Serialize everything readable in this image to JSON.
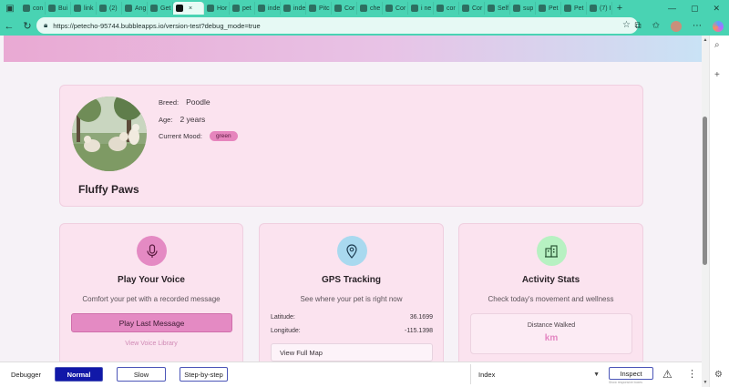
{
  "browser": {
    "tabs": [
      {
        "label": "con",
        "icon": "page-icon"
      },
      {
        "label": "Bui",
        "icon": "s-icon"
      },
      {
        "label": "link",
        "icon": "page-icon"
      },
      {
        "label": "(2)",
        "icon": "linkedin-icon"
      },
      {
        "label": "Ang",
        "icon": "page-icon"
      },
      {
        "label": "Get",
        "icon": "gear-icon"
      },
      {
        "label": "",
        "icon": "bubble-icon",
        "active": true,
        "close": "×"
      },
      {
        "label": "Hor",
        "icon": "bubble-icon"
      },
      {
        "label": "pet",
        "icon": "page-icon"
      },
      {
        "label": "inde",
        "icon": "bubble-icon"
      },
      {
        "label": "inde",
        "icon": "bubble-icon"
      },
      {
        "label": "Pitc",
        "icon": "page-icon"
      },
      {
        "label": "Cor",
        "icon": "page-icon"
      },
      {
        "label": "che",
        "icon": "page-icon"
      },
      {
        "label": "Cor",
        "icon": "google-icon"
      },
      {
        "label": "i ne",
        "icon": "page-icon"
      },
      {
        "label": "cor",
        "icon": "page-icon"
      },
      {
        "label": "Cor",
        "icon": "page-icon"
      },
      {
        "label": "Self",
        "icon": "n-icon"
      },
      {
        "label": "sup",
        "icon": "n-icon"
      },
      {
        "label": "Pet",
        "icon": "n-icon"
      },
      {
        "label": "Pet",
        "icon": "n-icon"
      },
      {
        "label": "(7) I",
        "icon": "x-icon"
      }
    ],
    "new_tab": "+",
    "url": "https://petecho-95744.bubbleapps.io/version-test?debug_mode=true"
  },
  "profile": {
    "breed_label": "Breed:",
    "breed_value": "Poodle",
    "age_label": "Age:",
    "age_value": "2 years",
    "mood_label": "Current Mood:",
    "mood_value": "green",
    "pet_name": "Fluffy Paws"
  },
  "features": {
    "voice": {
      "title": "Play Your Voice",
      "description": "Comfort your pet with a recorded message",
      "button": "Play Last Message",
      "link": "View Voice Library",
      "icon_color": "#e48ac3"
    },
    "gps": {
      "title": "GPS Tracking",
      "description": "See where your pet is right now",
      "latitude_label": "Latitude:",
      "latitude_value": "36.1699",
      "longitude_label": "Longitude:",
      "longitude_value": "-115.1398",
      "button": "View Full Map",
      "icon_color": "#a9d9ef"
    },
    "activity": {
      "title": "Activity Stats",
      "description": "Check today's movement and wellness",
      "stat_label": "Distance Walked",
      "stat_unit": "km",
      "icon_color": "#b7f1c2"
    }
  },
  "debugger": {
    "label": "Debugger",
    "normal": "Normal",
    "slow": "Slow",
    "step": "Step-by-step",
    "page": "Index",
    "inspect": "Inspect",
    "inspect_hint": "Show responsive boxes"
  },
  "colors": {
    "accent": "#49d3b3",
    "card": "#fbe3ef",
    "pink": "#e48ac3",
    "debug_active": "#1118a8"
  }
}
